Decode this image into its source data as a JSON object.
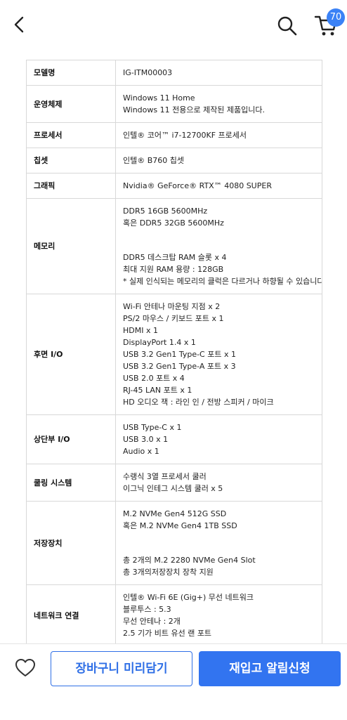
{
  "header": {
    "cart_count": "70"
  },
  "spec": {
    "rows": [
      {
        "key": "모델명",
        "lines": [
          "IG-ITM00003"
        ]
      },
      {
        "key": "운영체제",
        "lines": [
          "Windows 11 Home",
          "Windows 11 전용으로 제작된 제품입니다."
        ]
      },
      {
        "key": "프로세서",
        "lines": [
          "인텔® 코어™ i7-12700KF 프로세서"
        ]
      },
      {
        "key": "칩셋",
        "lines": [
          "인텔® B760 칩셋"
        ]
      },
      {
        "key": "그래픽",
        "lines": [
          "Nvidia® GeForce® RTX™ 4080 SUPER"
        ]
      },
      {
        "key": "메모리",
        "lines": [
          "DDR5 16GB 5600MHz",
          "혹은 DDR5 32GB 5600MHz",
          "",
          "DDR5 데스크탑 RAM 슬롯 x 4",
          "최대 지원 RAM 용량 : 128GB",
          "* 실제 인식되는 메모리의 클럭은 다르거나 하향될 수 있습니다."
        ]
      },
      {
        "key": "후면 I/O",
        "lines": [
          "Wi-Fi 안테나 마운팅 지점 x 2",
          "PS/2 마우스 / 키보드 포트 x 1",
          "HDMI x 1",
          "DisplayPort 1.4 x 1",
          "USB 3.2 Gen1 Type-C 포트 x 1",
          "USB 3.2 Gen1 Type-A 포트 x 3",
          "USB 2.0 포트 x 4",
          "RJ-45 LAN 포트 x 1",
          "HD 오디오 잭 : 라인 인 / 전방 스피커 / 마이크"
        ]
      },
      {
        "key": "상단부 I/O",
        "lines": [
          "USB Type-C x 1",
          "USB 3.0 x 1",
          "Audio x 1"
        ]
      },
      {
        "key": "쿨링 시스템",
        "lines": [
          "수랭식 3열 프로세서 쿨러",
          "이그닉 인테그 시스템 쿨러 x 5"
        ]
      },
      {
        "key": "저장장치",
        "lines": [
          "M.2 NVMe Gen4 512G SSD",
          "혹은 M.2 NVMe Gen4 1TB SSD",
          "",
          "총 2개의 M.2 2280 NVMe Gen4 Slot",
          "총 3개의저장장치 장착 지원"
        ]
      },
      {
        "key": "네트워크 연결",
        "lines": [
          "인텔® Wi-Fi 6E (Gig+) 무선 네트워크",
          "블루투스 : 5.3",
          "무선 안테나 : 2개",
          "2.5 기가 비트 유선 랜 포트"
        ]
      }
    ]
  },
  "actions": {
    "add_to_cart_label": "장바구니 미리담기",
    "restock_label": "재입고 알림신청"
  },
  "colors": {
    "accent": "#3274f0",
    "badge": "#3b82f6"
  }
}
